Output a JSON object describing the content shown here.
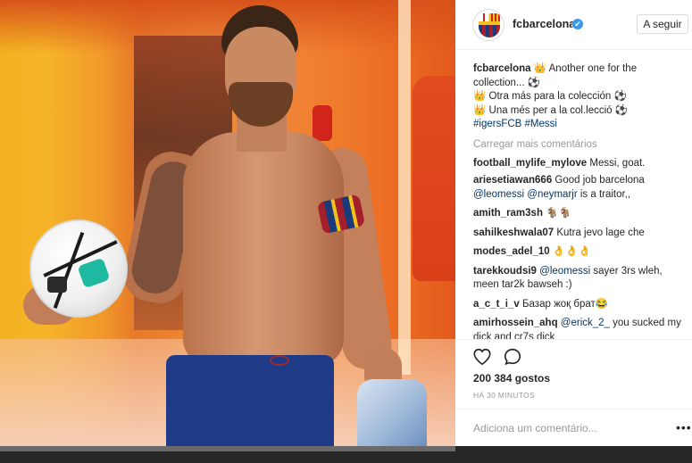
{
  "header": {
    "username": "fcbarcelona",
    "verified_mark": "✔",
    "follow_label": "A seguir"
  },
  "caption": {
    "username": "fcbarcelona",
    "line1": " 👑 Another one for the collection... ⚽",
    "line2": "👑 Otra más para la colección ⚽",
    "line3": "👑 Una més per a la col.lecció ⚽",
    "hashtags": "#igersFCB #Messi"
  },
  "load_more": "Carregar mais comentários",
  "comments": [
    {
      "user": "football_mylife_mylove",
      "text": " Messi, goat."
    },
    {
      "user": "ariesetiawan666",
      "text": " Good job barcelona ",
      "mention1": "@leomessi",
      "mention2": "@neymarjr",
      "text2": " is a traitor,,"
    },
    {
      "user": "amith_ram3sh",
      "text": " 🐐🐐"
    },
    {
      "user": "sahilkeshwala07",
      "text": " Kutra jevo lage che"
    },
    {
      "user": "modes_adel_10",
      "text": " 👌👌👌"
    },
    {
      "user": "tarekkoudsi9",
      "mention": "@leomessi",
      "text": " sayer 3rs wleh, meen tar2k bawseh :)"
    },
    {
      "user": "a_c_t_i_v",
      "text": " Базар жоқ брат😂"
    },
    {
      "user": "amirhossein_ahq",
      "mention": "@erick_2_",
      "text": " you sucked my dick and cr7s dick"
    }
  ],
  "actions": {
    "heart_icon": "heart-icon",
    "comment_icon": "comment-icon",
    "likes": "200 384 gostos",
    "time": "HÁ 30 MINUTOS"
  },
  "add_comment": {
    "placeholder": "Adiciona um comentário...",
    "more": "•••"
  },
  "colors": {
    "link": "#003569",
    "muted": "#999999",
    "text": "#262626",
    "verified": "#3897f0"
  }
}
